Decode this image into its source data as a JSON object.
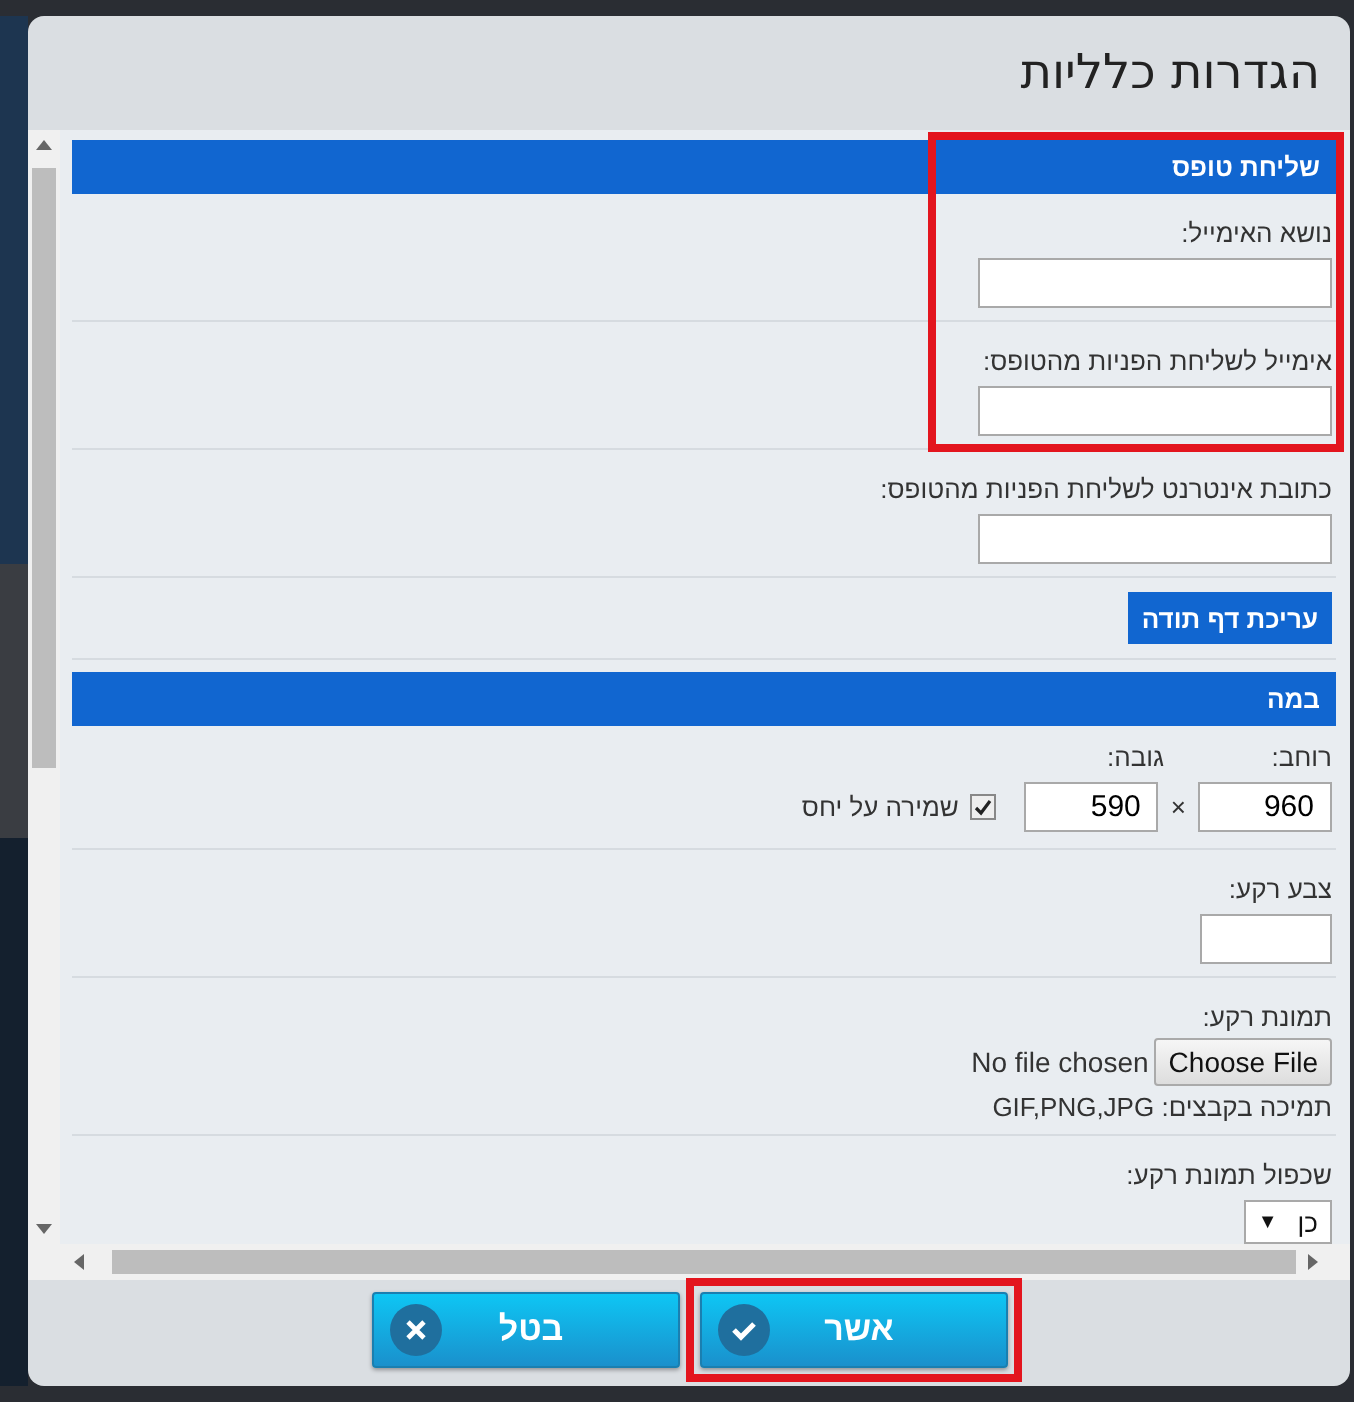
{
  "dialog": {
    "title": "הגדרות כלליות"
  },
  "sections": [
    {
      "title": "שליחת טופס",
      "highlighted": true,
      "rows": [
        {
          "kind": "text",
          "label": "נושא האימייל:",
          "highlighted": true
        },
        {
          "kind": "text",
          "label": "אימייל לשליחת הפניות מהטופס:",
          "highlighted": true
        },
        {
          "kind": "text",
          "label": "כתובת אינטרנט לשליחת הפניות מהטופס:",
          "highlighted": false
        },
        {
          "kind": "button",
          "label": "עריכת דף תודה",
          "highlighted": false
        }
      ]
    },
    {
      "title": "במה",
      "highlighted": false,
      "rows": [
        {
          "kind": "size",
          "width_label": "רוחב:",
          "width_value": "960",
          "times": "×",
          "height_label": "גובה:",
          "height_value": "590",
          "keep_ratio": {
            "label": "שמירה על יחס",
            "checked": true
          }
        },
        {
          "kind": "color",
          "label": "צבע רקע:"
        },
        {
          "kind": "file",
          "label": "תמונת רקע:",
          "button": "Choose File",
          "status": "No file chosen",
          "note": "תמיכה בקבצים: GIF,PNG,JPG"
        },
        {
          "kind": "select",
          "label": "שכפול תמונת רקע:",
          "value": "כן",
          "arrow": "▼"
        }
      ]
    }
  ],
  "buttons": [
    {
      "kind": "ok",
      "label": "אשר",
      "highlighted": true
    },
    {
      "kind": "cancel",
      "label": "בטל",
      "highlighted": false
    }
  ]
}
